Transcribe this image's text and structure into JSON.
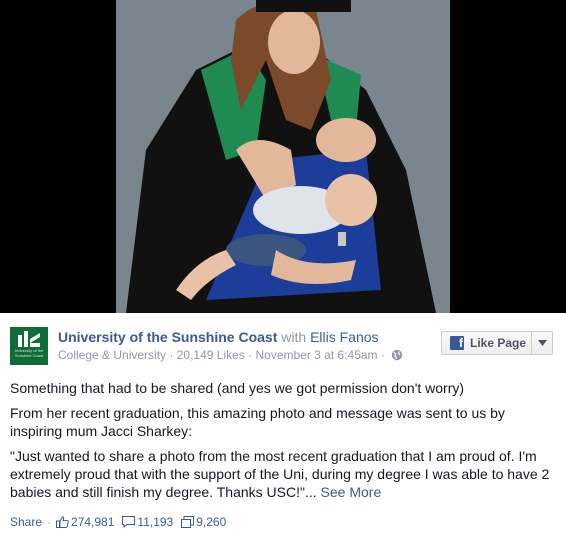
{
  "header": {
    "page_name": "University of the Sunshine Coast",
    "with_word": "with",
    "tagged_person": "Ellis Fanos",
    "category": "College & University",
    "likes": "20,149 Likes",
    "timestamp": "November 3 at 6:45am",
    "like_page_label": "Like Page",
    "avatar_text": "University of the\nSunshine Coast"
  },
  "body": {
    "line1": "Something that had to be shared (and yes we got permission don't worry)",
    "line2": "From her recent graduation, this amazing photo and message was sent to us by inspiring mum Jacci Sharkey:",
    "quote": "\"Just wanted to share a photo from the most recent graduation that I am proud of. I'm extremely proud that with the support of the Uni, during my degree I was able to have 2 babies and still finish my degree. Thanks USC!\"...",
    "see_more": "See More"
  },
  "footer": {
    "share_label": "Share",
    "likes_count": "274,981",
    "comments_count": "11,193",
    "shares_count": "9,260"
  },
  "colors": {
    "link": "#3b5998",
    "muted": "#9197a3",
    "brand_green": "#0f6b38"
  },
  "icons": [
    "globe-icon",
    "facebook-icon",
    "caret-down-icon",
    "thumbs-up-icon",
    "comment-icon",
    "share-icon"
  ]
}
